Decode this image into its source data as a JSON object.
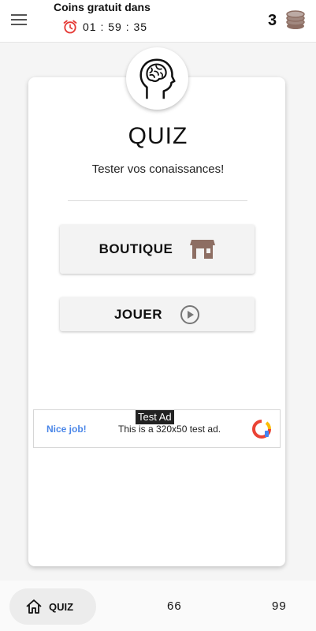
{
  "topbar": {
    "coins_title": "Coins gratuit dans",
    "timer": "01 : 59 : 35",
    "coin_count": "3"
  },
  "card": {
    "title": "QUIZ",
    "subtitle": "Tester vos conaissances!"
  },
  "buttons": {
    "shop_label": "BOUTIQUE",
    "play_label": "JOUER"
  },
  "ad": {
    "badge": "Test Ad",
    "nice": "Nice job!",
    "text": "This is a 320x50 test ad."
  },
  "bottom_nav": {
    "quiz_label": "QUIZ",
    "item2": "66",
    "item3": "99"
  },
  "colors": {
    "alarm": "#e53935",
    "coins": "#8d6e63",
    "ad_link": "#4a86e8",
    "icon_brown": "#8d6e63"
  },
  "icons": [
    "menu-icon",
    "alarm-icon",
    "coins-icon",
    "brain-head-icon",
    "store-icon",
    "play-circle-icon",
    "ad-logo-icon",
    "home-icon"
  ]
}
